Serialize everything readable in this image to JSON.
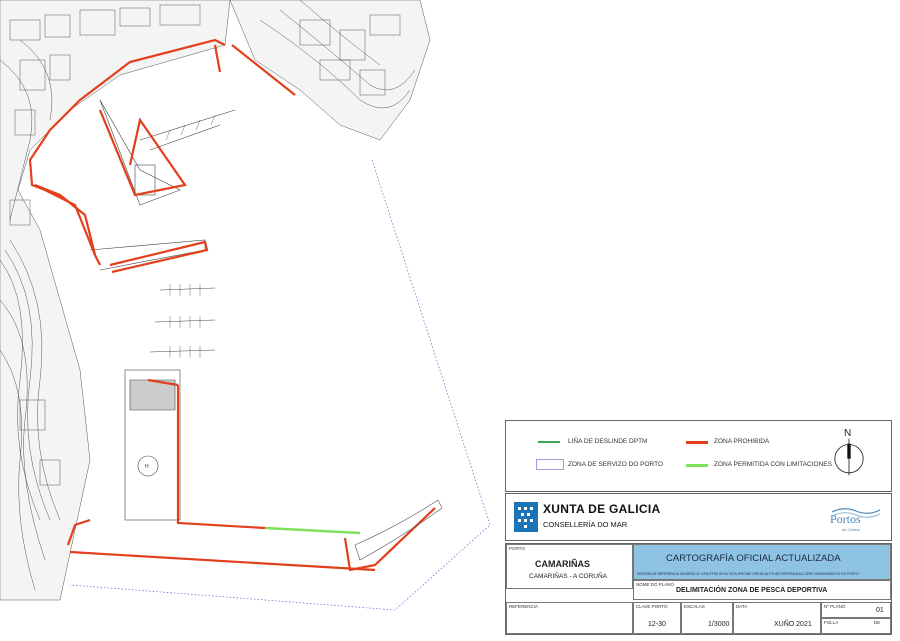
{
  "legend": {
    "items": [
      {
        "label": "LIÑA DE DESLINDE DPTM",
        "color": "#3aa655"
      },
      {
        "label": "ZONA PROHIBIDA",
        "color": "#e2401c"
      },
      {
        "label": "ZONA DE SERVIZO DO PORTO",
        "color": "#9aa0dd"
      },
      {
        "label": "ZONA PERMITIDA  CON LIMITACIONES",
        "color": "#7fe05a"
      }
    ],
    "compass_letter": "N"
  },
  "organization": {
    "xunta": "XUNTA DE GALICIA",
    "consellaria": "CONSELLERÍA DO MAR",
    "portos": "Portos",
    "portos_sub": "de Galicia"
  },
  "title_block": {
    "porto_label": "PORTO",
    "porto_name": "CAMARIÑAS",
    "porto_location": "CAMARIÑAS - A CORUÑA",
    "cartografia": "CARTOGRAFÍA  OFICIAL  ACTUALIZADA",
    "reference_system": "SISTEMA DE REFERENCIA XEODÉSICO: UTM-ETRS 89 HU 29   ELIPSOIDE GRS 80  ALTITUDE REFERIDA AO CERO HIDROGRÁFICO DO PORTO",
    "nome_label": "NOME DO PLANO",
    "nome_value": "DELIMITACIÓN ZONA DE PESCA DEPORTIVA",
    "referencia_label": "REFERENCIA",
    "clave_label": "CLAVE PORTO",
    "clave_value": "12-30",
    "escala_label": "ESCALAS",
    "escala_value": "1/3000",
    "data_label": "DATA",
    "data_value": "XUÑO 2021",
    "plano_label": "Nº PLANO",
    "plano_value": "01",
    "folla_label": "FOLLA",
    "de_label": "DE"
  }
}
